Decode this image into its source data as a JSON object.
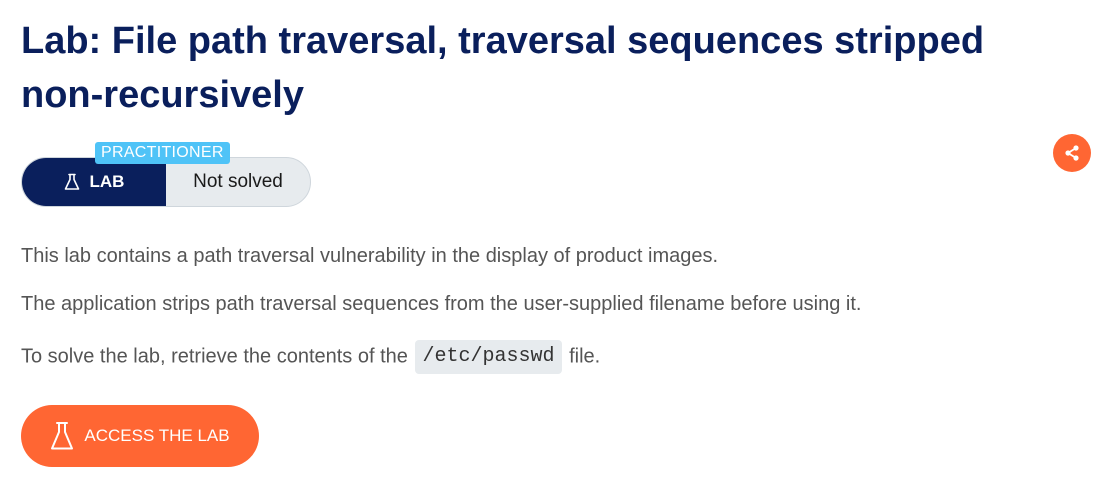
{
  "page": {
    "title": "Lab: File path traversal, traversal sequences stripped non-recursively"
  },
  "lab_widget": {
    "level": "PRACTITIONER",
    "lab_label": "LAB",
    "status": "Not solved"
  },
  "description": {
    "line1": "This lab contains a path traversal vulnerability in the display of product images.",
    "line2": "The application strips path traversal sequences from the user-supplied filename before using it.",
    "line3_before": "To solve the lab, retrieve the contents of the",
    "line3_code": "/etc/passwd",
    "line3_after": "file."
  },
  "actions": {
    "access_label": "ACCESS THE LAB"
  },
  "icons": {
    "share": "share-icon",
    "flask": "flask-icon"
  },
  "colors": {
    "title": "#0a1f5c",
    "accent_orange": "#ff6633",
    "badge_blue": "#4fc3f7",
    "pill_navy": "#0a1f5c"
  }
}
